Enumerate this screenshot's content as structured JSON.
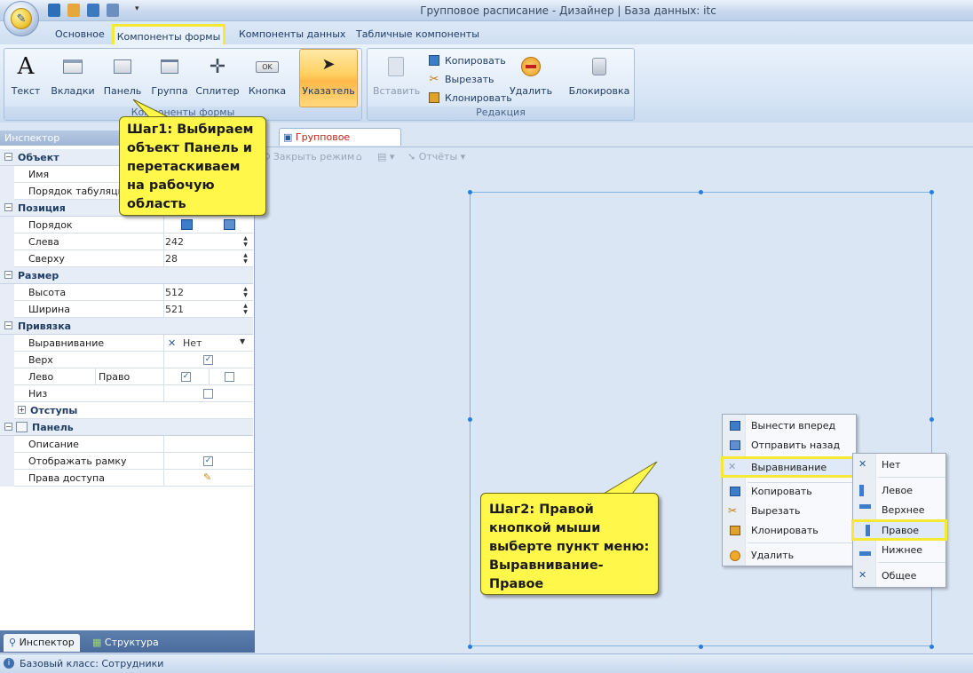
{
  "window": {
    "title": "Групповое расписание - Дизайнер | База данных: itc"
  },
  "ribbon_tabs": [
    "Основное",
    "Компоненты формы",
    "Компоненты данных",
    "Табличные компоненты"
  ],
  "form_group": {
    "label": "Компоненты формы",
    "buttons": [
      "Текст",
      "Вкладки",
      "Панель",
      "Группа",
      "Сплитер",
      "Кнопка"
    ],
    "pointer": "Указатель",
    "ok_caption": "OK"
  },
  "edit_group": {
    "label": "Редакция",
    "paste": "Вставить",
    "copy": "Копировать",
    "cut": "Вырезать",
    "clone": "Клонировать",
    "delete": "Удалить",
    "lock": "Блокировка"
  },
  "inspector": {
    "title": "Инспектор",
    "cats": {
      "object": "Объект",
      "position": "Позиция",
      "size": "Размер",
      "anchor": "Привязка",
      "padding": "Отступы",
      "panel": "Панель"
    },
    "props": {
      "name": "Имя",
      "tab_order": "Порядок табуляции",
      "order": "Порядок",
      "left": "Слева",
      "left_val": "242",
      "top": "Сверху",
      "top_val": "28",
      "height": "Высота",
      "height_val": "512",
      "width": "Ширина",
      "width_val": "521",
      "align": "Выравнивание",
      "align_val": "Нет",
      "anchor_top": "Верх",
      "anchor_left": "Лево",
      "anchor_right": "Право",
      "anchor_bottom": "Низ",
      "description": "Описание",
      "show_border": "Отображать рамку",
      "access": "Права доступа"
    },
    "tabs": {
      "inspector": "Инспектор",
      "structure": "Структура"
    }
  },
  "document": {
    "tab": "Групповое расписание",
    "toolbar": {
      "close": "Закрыть режим",
      "reports": "Отчёты"
    }
  },
  "context_menu": {
    "items": [
      "Вынести вперед",
      "Отправить назад",
      "Выравнивание",
      "Копировать",
      "Вырезать",
      "Клонировать",
      "Удалить"
    ]
  },
  "align_submenu": {
    "items": [
      "Нет",
      "Левое",
      "Верхнее",
      "Правое",
      "Нижнее",
      "Общее"
    ]
  },
  "callouts": {
    "step1": "Шаг1: Выбираем объект Панель и перетаскиваем на рабочую область",
    "step2": "Шаг2: Правой кнопкой мыши выберте пункт меню: Выравнивание-Правое"
  },
  "statusbar": {
    "text": "Базовый класс: Сотрудники"
  },
  "colors": {
    "highlight": "#f5e933",
    "callout": "#fff84a",
    "pointer_active": "#ffcf5e",
    "doc_tab_text": "#c0231a"
  }
}
